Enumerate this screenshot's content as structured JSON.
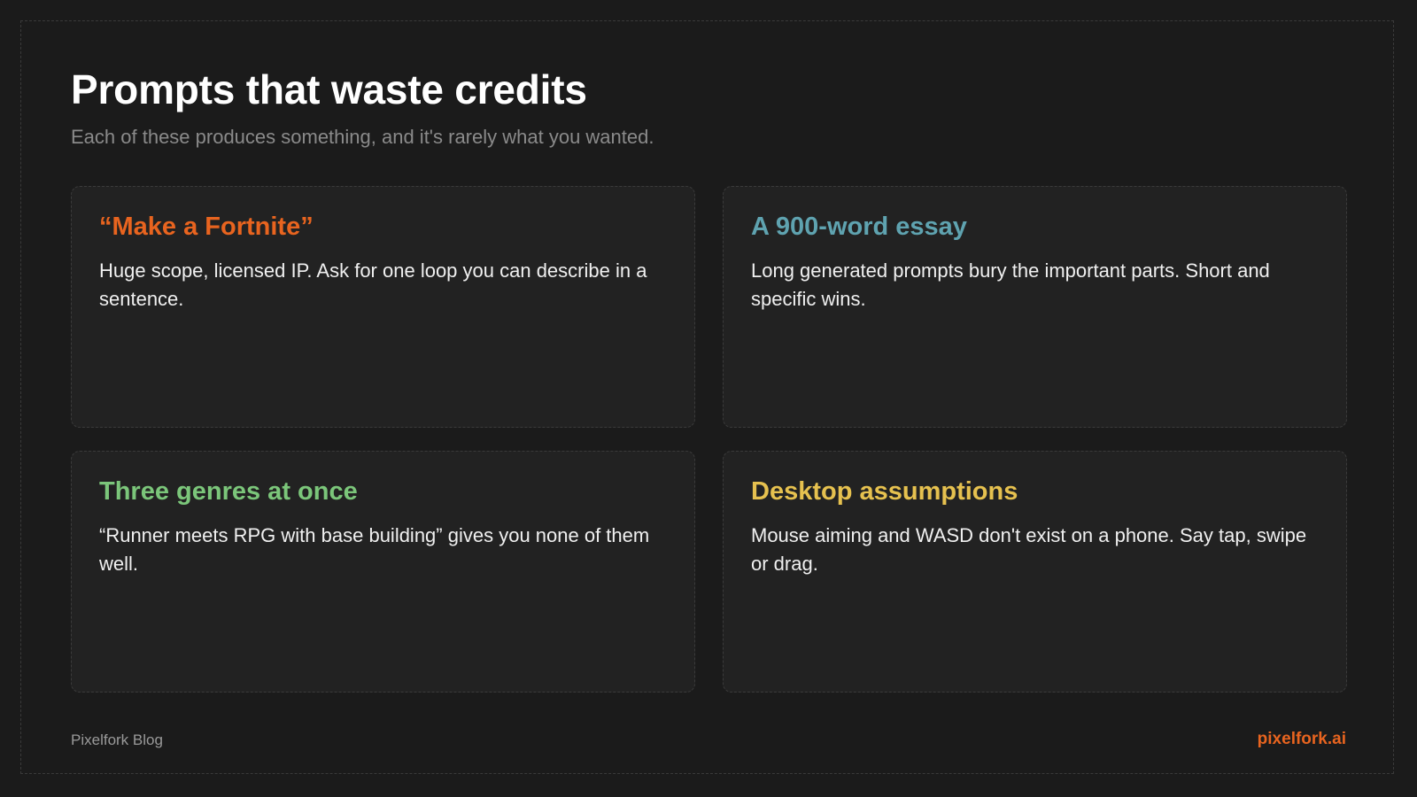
{
  "header": {
    "title": "Prompts that waste credits",
    "subtitle": "Each of these produces something, and it's rarely what you wanted."
  },
  "cards": [
    {
      "title": "“Make a Fortnite”",
      "body": "Huge scope, licensed IP. Ask for one loop you can describe in a sentence.",
      "color": "#e8641f"
    },
    {
      "title": "A 900-word essay",
      "body": "Long generated prompts bury the important parts. Short and specific wins.",
      "color": "#5fa3b0"
    },
    {
      "title": "Three genres at once",
      "body": "“Runner meets RPG with base building” gives you none of them well.",
      "color": "#7bc67a"
    },
    {
      "title": "Desktop assumptions",
      "body": "Mouse aiming and WASD don't exist on a phone. Say tap, swipe or drag.",
      "color": "#e6c14f"
    }
  ],
  "footer": {
    "left": "Pixelfork Blog",
    "right": "pixelfork.ai"
  },
  "colors": {
    "background": "#1b1b1b",
    "card_background": "#222222",
    "accent": "#e8641f"
  }
}
